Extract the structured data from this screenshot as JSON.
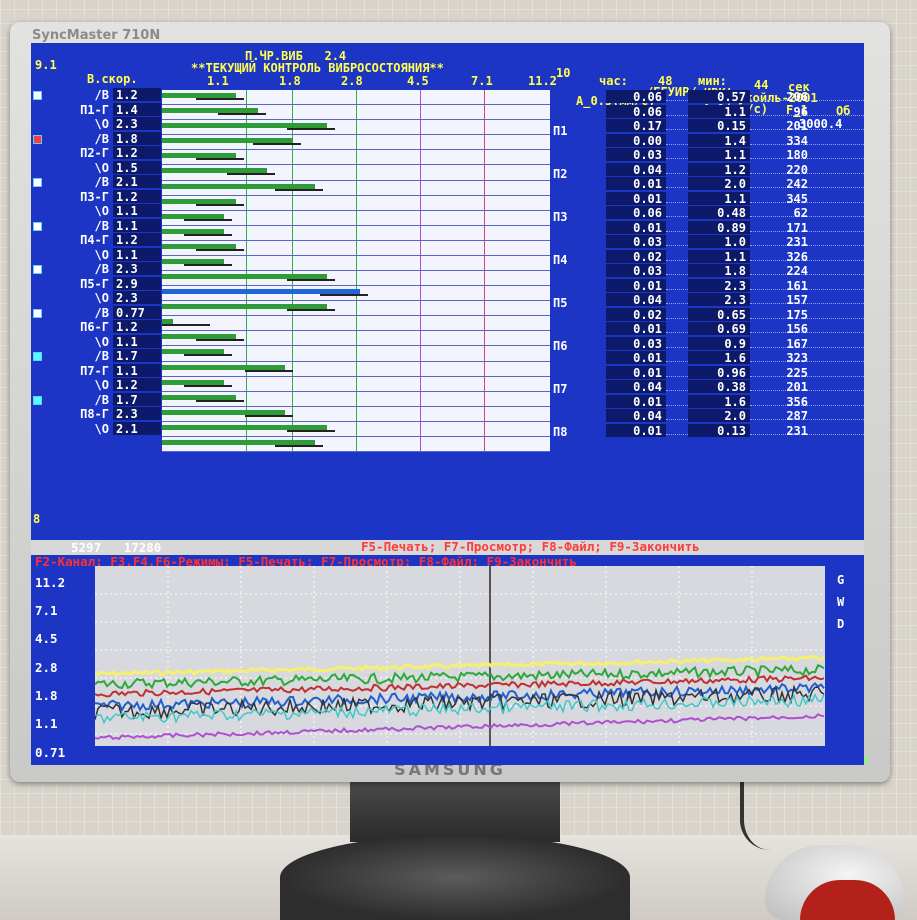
{
  "monitor": {
    "model": "SyncMaster 710N",
    "brand": "SAMSUNG"
  },
  "header": {
    "line1_left": "9.1",
    "line1_mid": "П.ЧР.ВИБ   2.4",
    "line2_title": "**ТЕКУЩИЙ КОНТРОЛЬ ВИБРОСОСТОЯНИЯ**",
    "col_label": "В.скор.",
    "scale_ticks": [
      "1.1",
      "1.8",
      "2.8",
      "4.5",
      "7.1",
      "11.2"
    ],
    "hour_num": "10",
    "hour_label": "час:",
    "min_num": "48",
    "min_label": "мин:",
    "sec_num": "44",
    "sec_label": "сек",
    "company": "Лукойль-2001",
    "a05": "А_0.5(мм/с)",
    "unit": "/БГУИР/",
    "ivk": "ИВК!",
    "a1": "А_1(мм/с)",
    "f1": "F_1",
    "ob": "Об",
    "rpm": "3000.4"
  },
  "channels": [
    {
      "label": "/В",
      "value": "1.2",
      "marker": "white"
    },
    {
      "label": "П1-Г",
      "value": "1.4",
      "marker": ""
    },
    {
      "label": "\\О",
      "value": "2.3",
      "marker": ""
    },
    {
      "label": "/В",
      "value": "1.8",
      "marker": "red"
    },
    {
      "label": "П2-Г",
      "value": "1.2",
      "marker": ""
    },
    {
      "label": "\\О",
      "value": "1.5",
      "marker": ""
    },
    {
      "label": "/В",
      "value": "2.1",
      "marker": "white"
    },
    {
      "label": "П3-Г",
      "value": "1.2",
      "marker": ""
    },
    {
      "label": "\\О",
      "value": "1.1",
      "marker": ""
    },
    {
      "label": "/В",
      "value": "1.1",
      "marker": "white"
    },
    {
      "label": "П4-Г",
      "value": "1.2",
      "marker": ""
    },
    {
      "label": "\\О",
      "value": "1.1",
      "marker": ""
    },
    {
      "label": "/В",
      "value": "2.3",
      "marker": "white"
    },
    {
      "label": "П5-Г",
      "value": "2.9",
      "marker": ""
    },
    {
      "label": "\\О",
      "value": "2.3",
      "marker": ""
    },
    {
      "label": "/В",
      "value": "0.77",
      "marker": "white"
    },
    {
      "label": "П6-Г",
      "value": "1.2",
      "marker": ""
    },
    {
      "label": "\\О",
      "value": "1.1",
      "marker": ""
    },
    {
      "label": "/В",
      "value": "1.7",
      "marker": "cyan"
    },
    {
      "label": "П7-Г",
      "value": "1.1",
      "marker": ""
    },
    {
      "label": "\\О",
      "value": "1.2",
      "marker": ""
    },
    {
      "label": "/В",
      "value": "1.7",
      "marker": "cyan"
    },
    {
      "label": "П8-Г",
      "value": "2.3",
      "marker": ""
    },
    {
      "label": "\\О",
      "value": "2.1",
      "marker": ""
    }
  ],
  "groups": [
    "П1",
    "П2",
    "П3",
    "П4",
    "П5",
    "П6",
    "П7",
    "П8"
  ],
  "table": [
    {
      "a05": "0.06",
      "a1": "0.57",
      "f1": "206"
    },
    {
      "a05": "0.06",
      "a1": "1.1",
      "f1": "96"
    },
    {
      "a05": "0.17",
      "a1": "0.15",
      "f1": "201"
    },
    {
      "a05": "0.00",
      "a1": "1.4",
      "f1": "334"
    },
    {
      "a05": "0.03",
      "a1": "1.1",
      "f1": "180"
    },
    {
      "a05": "0.04",
      "a1": "1.2",
      "f1": "220"
    },
    {
      "a05": "0.01",
      "a1": "2.0",
      "f1": "242"
    },
    {
      "a05": "0.01",
      "a1": "1.1",
      "f1": "345"
    },
    {
      "a05": "0.06",
      "a1": "0.48",
      "f1": "62"
    },
    {
      "a05": "0.01",
      "a1": "0.89",
      "f1": "171"
    },
    {
      "a05": "0.03",
      "a1": "1.0",
      "f1": "231"
    },
    {
      "a05": "0.02",
      "a1": "1.1",
      "f1": "326"
    },
    {
      "a05": "0.03",
      "a1": "1.8",
      "f1": "224"
    },
    {
      "a05": "0.01",
      "a1": "2.3",
      "f1": "161"
    },
    {
      "a05": "0.04",
      "a1": "2.3",
      "f1": "157"
    },
    {
      "a05": "0.02",
      "a1": "0.65",
      "f1": "175"
    },
    {
      "a05": "0.01",
      "a1": "0.69",
      "f1": "156"
    },
    {
      "a05": "0.03",
      "a1": "0.9",
      "f1": "167"
    },
    {
      "a05": "0.01",
      "a1": "1.6",
      "f1": "323"
    },
    {
      "a05": "0.01",
      "a1": "0.96",
      "f1": "225"
    },
    {
      "a05": "0.04",
      "a1": "0.38",
      "f1": "201"
    },
    {
      "a05": "0.01",
      "a1": "1.6",
      "f1": "356"
    },
    {
      "a05": "0.04",
      "a1": "2.0",
      "f1": "287"
    },
    {
      "a05": "0.01",
      "a1": "0.13",
      "f1": "231"
    }
  ],
  "status": {
    "digit": "8",
    "counter1": "5297",
    "counter2": "17280",
    "fkeys_top": "F5-Печать; F7-Просмотр; F8-Файл; F9-Закончить",
    "fkeys": "F2-Канал; F3,F4,F6-Режимы; F5-Печать; F7-Просмотр; F8-Файл; F9-Закончить"
  },
  "trend": {
    "y_ticks": [
      "11.2",
      "7.1",
      "4.5",
      "2.8",
      "1.8",
      "1.1",
      "0.71"
    ],
    "side_letters": [
      "G",
      "W",
      "D"
    ]
  },
  "colors": {
    "screen_bg": "#1d35c4",
    "bar_green": "#2f9c3a",
    "bar_blue": "#2166d8",
    "bar_dark": "#222222",
    "grid_green": "#2fb045",
    "grid_violet": "#b050d0",
    "grid_red": "#d04a60"
  },
  "chart_data": {
    "type": "bar",
    "categories": [
      "/В",
      "П1-Г",
      "\\О",
      "/В",
      "П2-Г",
      "\\О",
      "/В",
      "П3-Г",
      "\\О",
      "/В",
      "П4-Г",
      "\\О",
      "/В",
      "П5-Г",
      "\\О",
      "/В",
      "П6-Г",
      "\\О",
      "/В",
      "П7-Г",
      "\\О",
      "/В",
      "П8-Г",
      "\\О"
    ],
    "values": [
      1.2,
      1.4,
      2.3,
      1.8,
      1.2,
      1.5,
      2.1,
      1.2,
      1.1,
      1.1,
      1.2,
      1.1,
      2.3,
      2.9,
      2.3,
      0.77,
      1.2,
      1.1,
      1.7,
      1.1,
      1.2,
      1.7,
      2.3,
      2.1
    ],
    "scale": "log",
    "xlim": [
      0.71,
      11.2
    ]
  }
}
